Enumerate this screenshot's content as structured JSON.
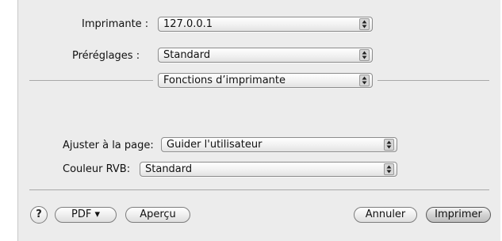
{
  "printer": {
    "label": "Imprimante :",
    "value": "127.0.0.1"
  },
  "presets": {
    "label": "Préréglages :",
    "value": "Standard"
  },
  "pane": {
    "value": "Fonctions d’imprimante"
  },
  "fit_to_page": {
    "label": "Ajuster à la page:",
    "value": "Guider l'utilisateur"
  },
  "rgb_color": {
    "label": "Couleur RVB:",
    "value": "Standard"
  },
  "footer": {
    "help": "?",
    "pdf": "PDF ▾",
    "preview": "Aperçu",
    "cancel": "Annuler",
    "print": "Imprimer"
  },
  "icons": {
    "popup_arrows": "up-down-arrows-icon",
    "help": "help-icon"
  }
}
